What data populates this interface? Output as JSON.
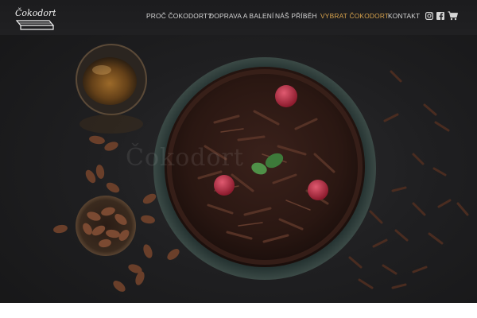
{
  "brand": {
    "logo_text": "Čokodort",
    "watermark_text": "Čokodort"
  },
  "nav": {
    "items": [
      {
        "label": "PROČ ČOKODORT?",
        "active": false
      },
      {
        "label": "DOPRAVA A BALENÍ",
        "active": false
      },
      {
        "label": "NÁŠ PŘÍBĚH",
        "active": false
      },
      {
        "label": "VYBRAT ČOKODORT",
        "active": true
      },
      {
        "label": "KONTAKT",
        "active": false
      }
    ]
  },
  "icons": {
    "instagram": "instagram-icon",
    "facebook": "facebook-icon",
    "cart": "shopping-cart-icon"
  },
  "colors": {
    "nav_text": "#d6d6d6",
    "nav_active": "#d7a24c",
    "background": "#1f1f21"
  }
}
